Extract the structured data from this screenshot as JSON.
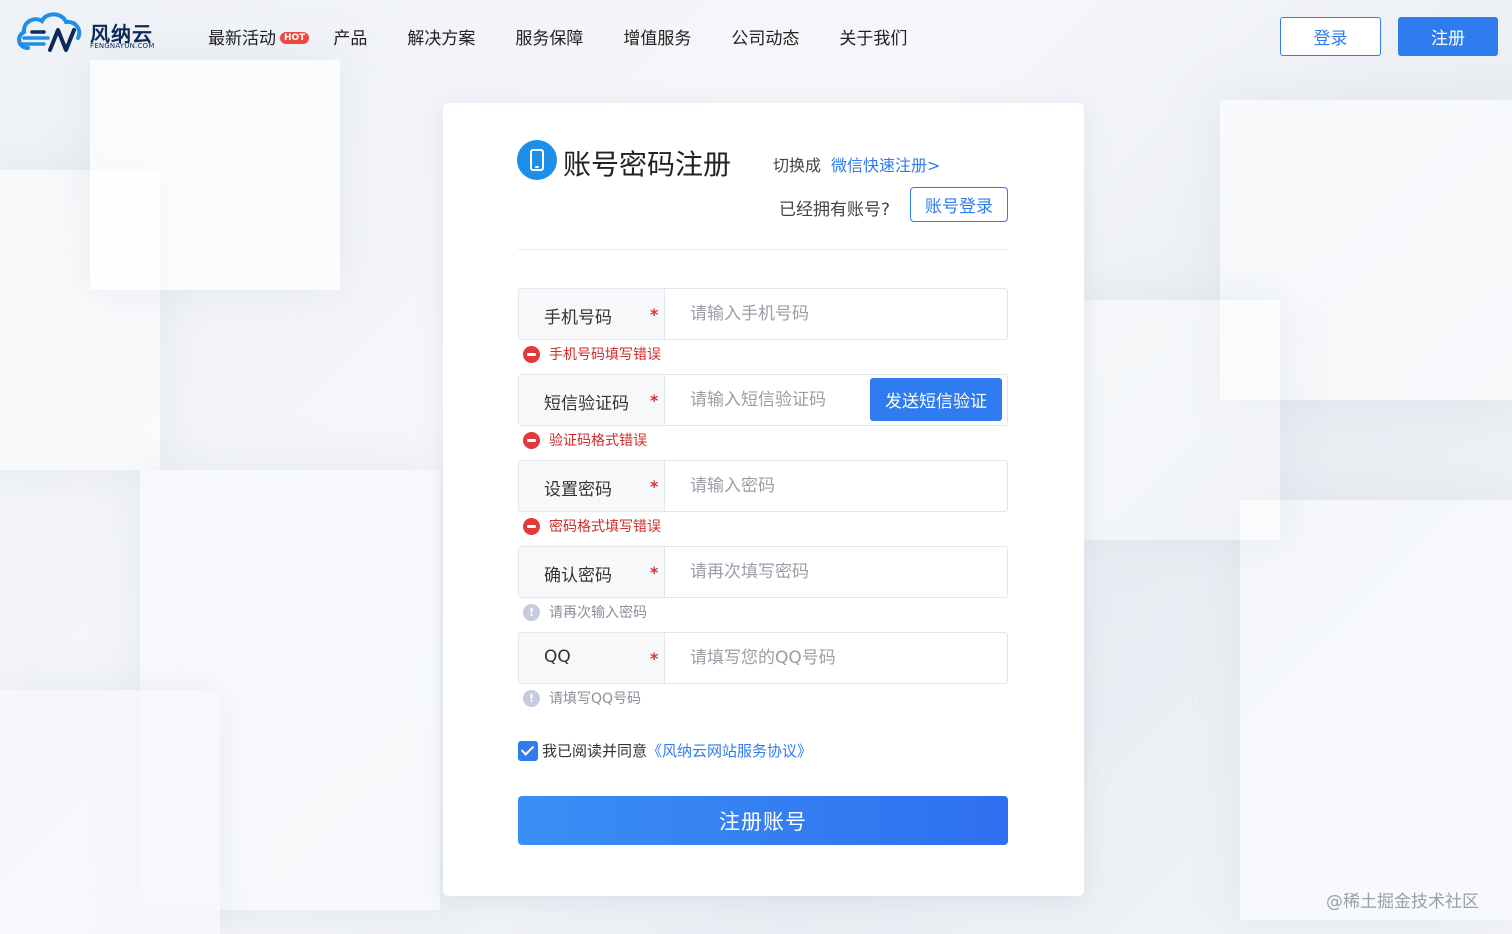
{
  "header": {
    "logo_name": "风纳云",
    "logo_sub": "FENGNAYUN.COM",
    "nav": [
      {
        "label": "最新活动",
        "badge": "HOT"
      },
      {
        "label": "产品"
      },
      {
        "label": "解决方案"
      },
      {
        "label": "服务保障"
      },
      {
        "label": "增值服务"
      },
      {
        "label": "公司动态"
      },
      {
        "label": "关于我们"
      }
    ],
    "login_label": "登录",
    "register_label": "注册"
  },
  "card": {
    "title_icon": "phone-icon",
    "title": "账号密码注册",
    "switch_prefix": "切换成",
    "switch_link": "微信快速注册>",
    "have_account": "已经拥有账号?",
    "account_login": "账号登录",
    "fields": [
      {
        "label": "手机号码",
        "required": "*",
        "placeholder": "请输入手机号码",
        "hint": "手机号码填写错误",
        "hint_type": "error"
      },
      {
        "label": "短信验证码",
        "required": "*",
        "placeholder": "请输入短信验证码",
        "button": "发送短信验证",
        "hint": "验证码格式错误",
        "hint_type": "error"
      },
      {
        "label": "设置密码",
        "required": "*",
        "placeholder": "请输入密码",
        "hint": "密码格式填写错误",
        "hint_type": "error"
      },
      {
        "label": "确认密码",
        "required": "*",
        "placeholder": "请再次填写密码",
        "hint": "请再次输入密码",
        "hint_type": "info"
      },
      {
        "label": "QQ",
        "required": "*",
        "placeholder": "请填写您的QQ号码",
        "hint": "请填写QQ号码",
        "hint_type": "info"
      }
    ],
    "agree_checked": true,
    "agree_text": "我已阅读并同意",
    "agree_link": "《风纳云网站服务协议》",
    "submit_label": "注册账号"
  },
  "watermark": "@稀土掘金技术社区",
  "colors": {
    "accent": "#2f7bf0",
    "error": "#d02a2a",
    "hot_badge": "#f0473e"
  }
}
